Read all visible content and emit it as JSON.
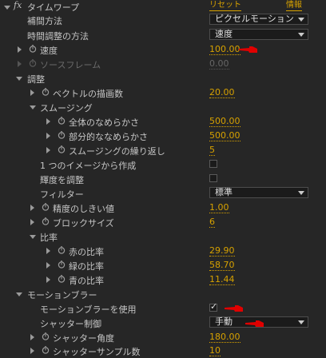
{
  "effect": {
    "fx_icon": "fx",
    "name": "タイムワープ",
    "reset_label": "リセット",
    "about_label": "情報"
  },
  "rows": {
    "method": {
      "label": "補間方法",
      "value": "ピクセルモーション"
    },
    "adjust": {
      "label": "時間調整の方法",
      "value": "速度"
    },
    "speed": {
      "label": "速度",
      "value": "100.00"
    },
    "source_frame": {
      "label": "ソースフレーム",
      "value": "0.00"
    },
    "tuning": {
      "label": "調整"
    },
    "vector_detail": {
      "label": "ベクトルの描画数",
      "value": "20.00"
    },
    "smoothing": {
      "label": "スムージング"
    },
    "global_smooth": {
      "label": "全体のなめらかさ",
      "value": "500.00"
    },
    "local_smooth": {
      "label": "部分的ななめらかさ",
      "value": "500.00"
    },
    "smooth_iter": {
      "label": "スムージングの繰り返し",
      "value": "5"
    },
    "single_image": {
      "label": "1 つのイメージから作成"
    },
    "luminance": {
      "label": "輝度を調整"
    },
    "filter": {
      "label": "フィルター",
      "value": "標準"
    },
    "err_threshold": {
      "label": "精度のしきい値",
      "value": "1.00"
    },
    "block_size": {
      "label": "ブロックサイズ",
      "value": "6"
    },
    "weighting": {
      "label": "比率"
    },
    "red_weight": {
      "label": "赤の比率",
      "value": "29.90"
    },
    "green_weight": {
      "label": "緑の比率",
      "value": "58.70"
    },
    "blue_weight": {
      "label": "青の比率",
      "value": "11.44"
    },
    "motion_blur": {
      "label": "モーションブラー"
    },
    "use_mb": {
      "label": "モーションブラーを使用",
      "checked": true
    },
    "shutter_control": {
      "label": "シャッター制御",
      "value": "手動"
    },
    "shutter_angle": {
      "label": "シャッター角度",
      "value": "180.00"
    },
    "shutter_samples": {
      "label": "シャッターサンプル数",
      "value": "10"
    }
  },
  "colors": {
    "value": "#d6a100",
    "annotation": "#e00000",
    "background": "#262626"
  },
  "icons": {
    "stopwatch": "stopwatch-icon",
    "twirl": "twirl-arrow-icon",
    "cursor": "red-hand-pointer-icon"
  }
}
